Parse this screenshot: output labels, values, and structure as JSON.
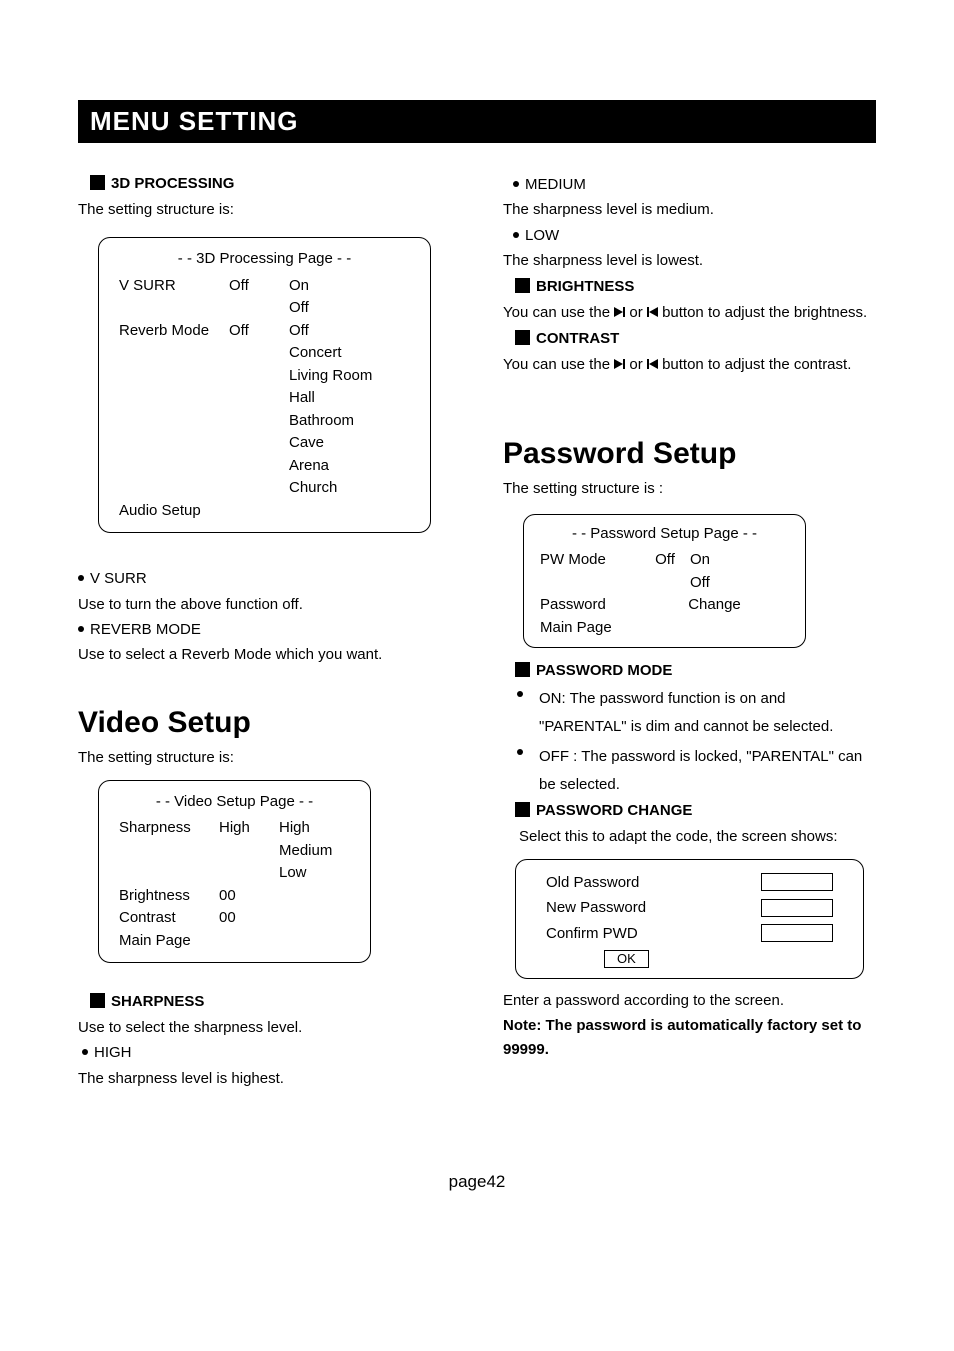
{
  "banner": "MENU SETTING",
  "left": {
    "sec1": {
      "title": "3D PROCESSING",
      "intro": "The setting structure is:",
      "panel": {
        "title": "- - 3D Processing Page - -",
        "row1": {
          "name": "V SURR",
          "cur": "Off",
          "opts": [
            "On",
            "Off"
          ]
        },
        "row2": {
          "name": "Reverb Mode",
          "cur": "Off",
          "opts": [
            "Off",
            "Concert",
            "Living Room",
            "Hall",
            "Bathroom",
            "Cave",
            "Arena",
            "Church"
          ]
        },
        "row3": "Audio Setup"
      },
      "b1_name": "V SURR",
      "b1_text": "Use to turn the above function off.",
      "b2_name": "REVERB MODE",
      "b2_text": "Use to select a Reverb Mode which you want."
    },
    "video": {
      "heading": "Video Setup",
      "intro": "The setting structure is:",
      "panel": {
        "title": "- - Video Setup Page - -",
        "sharp": {
          "name": "Sharpness",
          "cur": "High",
          "opts": [
            "High",
            "Medium",
            "Low"
          ]
        },
        "bright": {
          "name": "Brightness",
          "val": "00"
        },
        "contrast": {
          "name": "Contrast",
          "val": "00"
        },
        "main": "Main Page"
      },
      "sharp_title": "SHARPNESS",
      "sharp_text": "Use to select the sharpness level.",
      "high_name": "HIGH",
      "high_text": "The sharpness level is highest."
    }
  },
  "right": {
    "med_name": "MEDIUM",
    "med_text": "The sharpness level is medium.",
    "low_name": "LOW",
    "low_text": "The sharpness level is lowest.",
    "bright_title": "BRIGHTNESS",
    "bright_text1": "You can use the ",
    "bright_text2": " or ",
    "bright_text3": " button to adjust the brightness.",
    "contrast_title": "CONTRAST",
    "contrast_text1": "You can use the ",
    "contrast_text2": " or ",
    "contrast_text3": " button to adjust the contrast.",
    "pw_heading": "Password Setup",
    "pw_intro": "The setting structure is :",
    "pw_panel": {
      "title": "- - Password Setup Page - -",
      "mode": {
        "name": "PW Mode",
        "cur": "Off",
        "opts": [
          "On",
          "Off"
        ]
      },
      "pass": {
        "name": "Password",
        "val": "Change"
      },
      "main": "Main Page"
    },
    "pwmode_title": "PASSWORD MODE",
    "pwmode_on": "ON: The password function is on and \"PARENTAL\" is dim and cannot be selected.",
    "pwmode_off": "OFF : The  password  is  locked, \"PARENTAL\" can be selected.",
    "pwchange_title": "PASSWORD CHANGE",
    "pwchange_text": "Select this to adapt the code, the screen shows:",
    "pwchange_panel": {
      "old": "Old Password",
      "new": "New Password",
      "conf": "Confirm PWD",
      "ok": "OK"
    },
    "enter_text": "Enter a password according to the screen.",
    "note": "Note: The  password  is  automatically factory set to 99999."
  },
  "footer": "page42"
}
